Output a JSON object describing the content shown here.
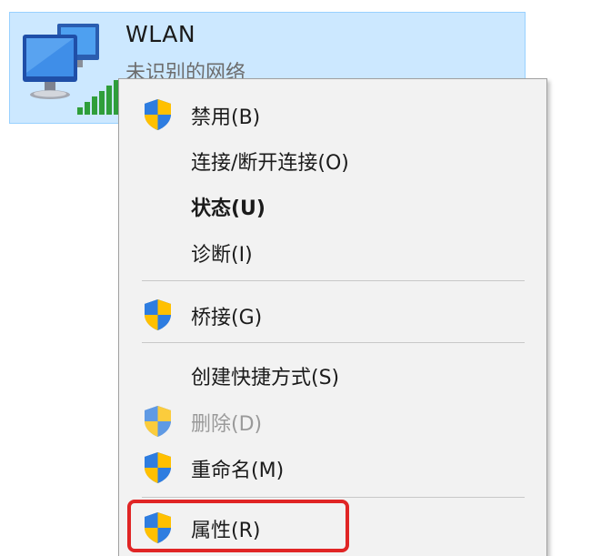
{
  "adapter": {
    "name": "WLAN",
    "status": "未识别的网络",
    "icon": "network-adapter-icon"
  },
  "menu": {
    "items": [
      {
        "label": "禁用(B)",
        "shield": true
      },
      {
        "label": "连接/断开连接(O)",
        "shield": false
      },
      {
        "label": "状态(U)",
        "shield": false,
        "bold": true
      },
      {
        "label": "诊断(I)",
        "shield": false
      },
      {
        "label": "桥接(G)",
        "shield": true
      },
      {
        "label": "创建快捷方式(S)",
        "shield": false
      },
      {
        "label": "删除(D)",
        "shield": true,
        "disabled": true
      },
      {
        "label": "重命名(M)",
        "shield": true
      },
      {
        "label": "属性(R)",
        "shield": true,
        "highlighted": true
      }
    ]
  },
  "colors": {
    "selection_background": "#cce8ff",
    "menu_background": "#f2f2f2",
    "highlight_border": "#e02525",
    "shield_blue": "#1f5fc4",
    "shield_yellow": "#ffc000"
  }
}
